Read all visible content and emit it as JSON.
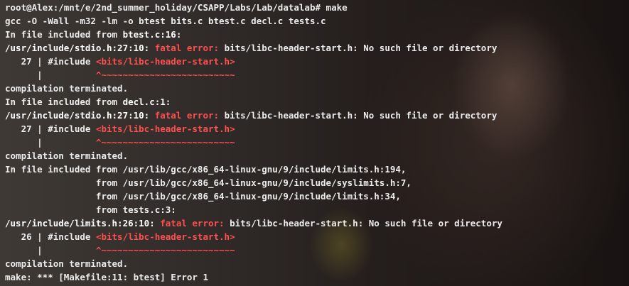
{
  "terminal": {
    "lines": [
      [
        {
          "t": "root@Alex:/mnt/e/2nd_summer_holiday/CSAPP/Labs/Lab/datalab# make",
          "c": ""
        }
      ],
      [
        {
          "t": "gcc -O -Wall -m32 -lm -o btest bits.c btest.c decl.c tests.c",
          "c": ""
        }
      ],
      [
        {
          "t": "In file included from ",
          "c": ""
        },
        {
          "t": "btest.c:16",
          "c": "w"
        },
        {
          "t": ":",
          "c": ""
        }
      ],
      [
        {
          "t": "/usr/include/stdio.h:27:10: ",
          "c": "w"
        },
        {
          "t": "fatal error: ",
          "c": "red"
        },
        {
          "t": "bits/libc-header-start.h: No such file or directory",
          "c": ""
        }
      ],
      [
        {
          "t": "   27 | #include ",
          "c": ""
        },
        {
          "t": "<bits/libc-header-start.h>",
          "c": "red"
        }
      ],
      [
        {
          "t": "      |          ",
          "c": ""
        },
        {
          "t": "^~~~~~~~~~~~~~~~~~~~~~~~~~",
          "c": "red"
        }
      ],
      [
        {
          "t": "compilation terminated.",
          "c": ""
        }
      ],
      [
        {
          "t": "In file included from ",
          "c": ""
        },
        {
          "t": "decl.c:1",
          "c": "w"
        },
        {
          "t": ":",
          "c": ""
        }
      ],
      [
        {
          "t": "/usr/include/stdio.h:27:10: ",
          "c": "w"
        },
        {
          "t": "fatal error: ",
          "c": "red"
        },
        {
          "t": "bits/libc-header-start.h: No such file or directory",
          "c": ""
        }
      ],
      [
        {
          "t": "   27 | #include ",
          "c": ""
        },
        {
          "t": "<bits/libc-header-start.h>",
          "c": "red"
        }
      ],
      [
        {
          "t": "      |          ",
          "c": ""
        },
        {
          "t": "^~~~~~~~~~~~~~~~~~~~~~~~~~",
          "c": "red"
        }
      ],
      [
        {
          "t": "compilation terminated.",
          "c": ""
        }
      ],
      [
        {
          "t": "In file included from /usr/lib/gcc/x86_64-linux-gnu/9/include/limits.h:194,",
          "c": ""
        }
      ],
      [
        {
          "t": "                 from /usr/lib/gcc/x86_64-linux-gnu/9/include/syslimits.h:7,",
          "c": ""
        }
      ],
      [
        {
          "t": "                 from /usr/lib/gcc/x86_64-linux-gnu/9/include/limits.h:34,",
          "c": ""
        }
      ],
      [
        {
          "t": "                 from tests.c:3:",
          "c": ""
        }
      ],
      [
        {
          "t": "/usr/include/limits.h:26:10: ",
          "c": "w"
        },
        {
          "t": "fatal error: ",
          "c": "red"
        },
        {
          "t": "bits/libc-header-start.h: No such file or directory",
          "c": ""
        }
      ],
      [
        {
          "t": "   26 | #include ",
          "c": ""
        },
        {
          "t": "<bits/libc-header-start.h>",
          "c": "red"
        }
      ],
      [
        {
          "t": "      |          ",
          "c": ""
        },
        {
          "t": "^~~~~~~~~~~~~~~~~~~~~~~~~~",
          "c": "red"
        }
      ],
      [
        {
          "t": "compilation terminated.",
          "c": ""
        }
      ],
      [
        {
          "t": "make: *** [Makefile:11: btest] Error 1",
          "c": ""
        }
      ]
    ]
  },
  "colors": {
    "text": "#ececec",
    "error": "#ff4f4f"
  }
}
